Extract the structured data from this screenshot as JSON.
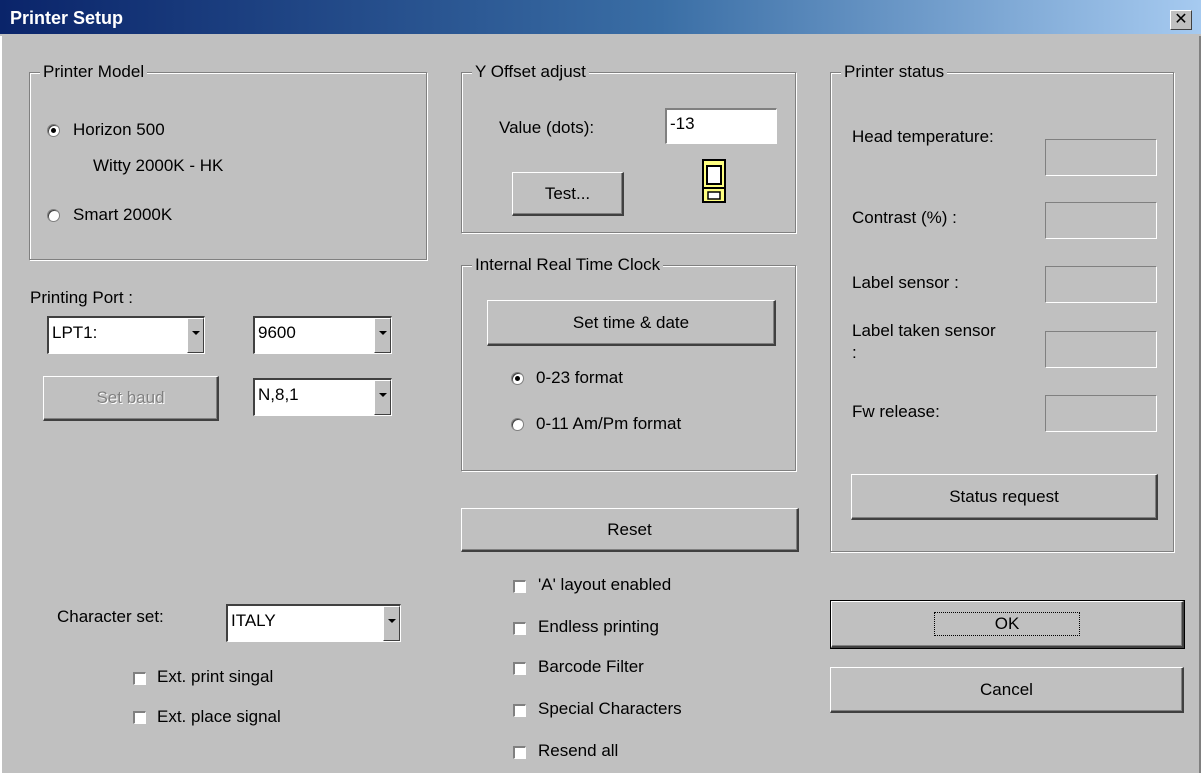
{
  "window": {
    "title": "Printer Setup",
    "close_glyph": "✕"
  },
  "printer_model": {
    "legend": "Printer Model",
    "options": [
      {
        "label": "Horizon 500",
        "selected": true
      },
      {
        "label": "Smart 2000K",
        "selected": false
      }
    ],
    "note": "Witty 2000K - HK"
  },
  "printing_port": {
    "label": "Printing Port :",
    "port": "LPT1:",
    "baud": "9600",
    "parity": "N,8,1",
    "set_baud_button": "Set baud"
  },
  "character_set": {
    "label": "Character set:",
    "value": "ITALY"
  },
  "left_checks": [
    {
      "label": "Ext. print singal",
      "checked": false
    },
    {
      "label": "Ext. place signal",
      "checked": false
    }
  ],
  "y_offset": {
    "legend": "Y Offset adjust",
    "value_label": "Value (dots):",
    "value": "-13",
    "test_button": "Test...",
    "icon": "label-roll-icon"
  },
  "clock": {
    "legend": "Internal Real Time Clock",
    "set_button": "Set time & date",
    "formats": [
      {
        "label": "0-23 format",
        "selected": true
      },
      {
        "label": "0-11 Am/Pm format",
        "selected": false
      }
    ]
  },
  "reset_button": "Reset",
  "middle_checks": [
    {
      "label": "'A' layout enabled",
      "checked": false
    },
    {
      "label": "Endless printing",
      "checked": false
    },
    {
      "label": "Barcode Filter",
      "checked": false
    },
    {
      "label": "Special Characters",
      "checked": false
    },
    {
      "label": "Resend all",
      "checked": false
    }
  ],
  "printer_status": {
    "legend": "Printer status",
    "fields": [
      {
        "label": "Head temperature:",
        "value": ""
      },
      {
        "label": "Contrast (%) :",
        "value": ""
      },
      {
        "label": "Label sensor :",
        "value": ""
      },
      {
        "label": "Label taken sensor :",
        "value": ""
      },
      {
        "label": "Fw release:",
        "value": ""
      }
    ],
    "status_button": "Status request"
  },
  "ok_button": "OK",
  "cancel_button": "Cancel",
  "colors": {
    "face": "#c0c0c0",
    "title_start": "#0a246a",
    "title_end": "#a6caf0"
  }
}
